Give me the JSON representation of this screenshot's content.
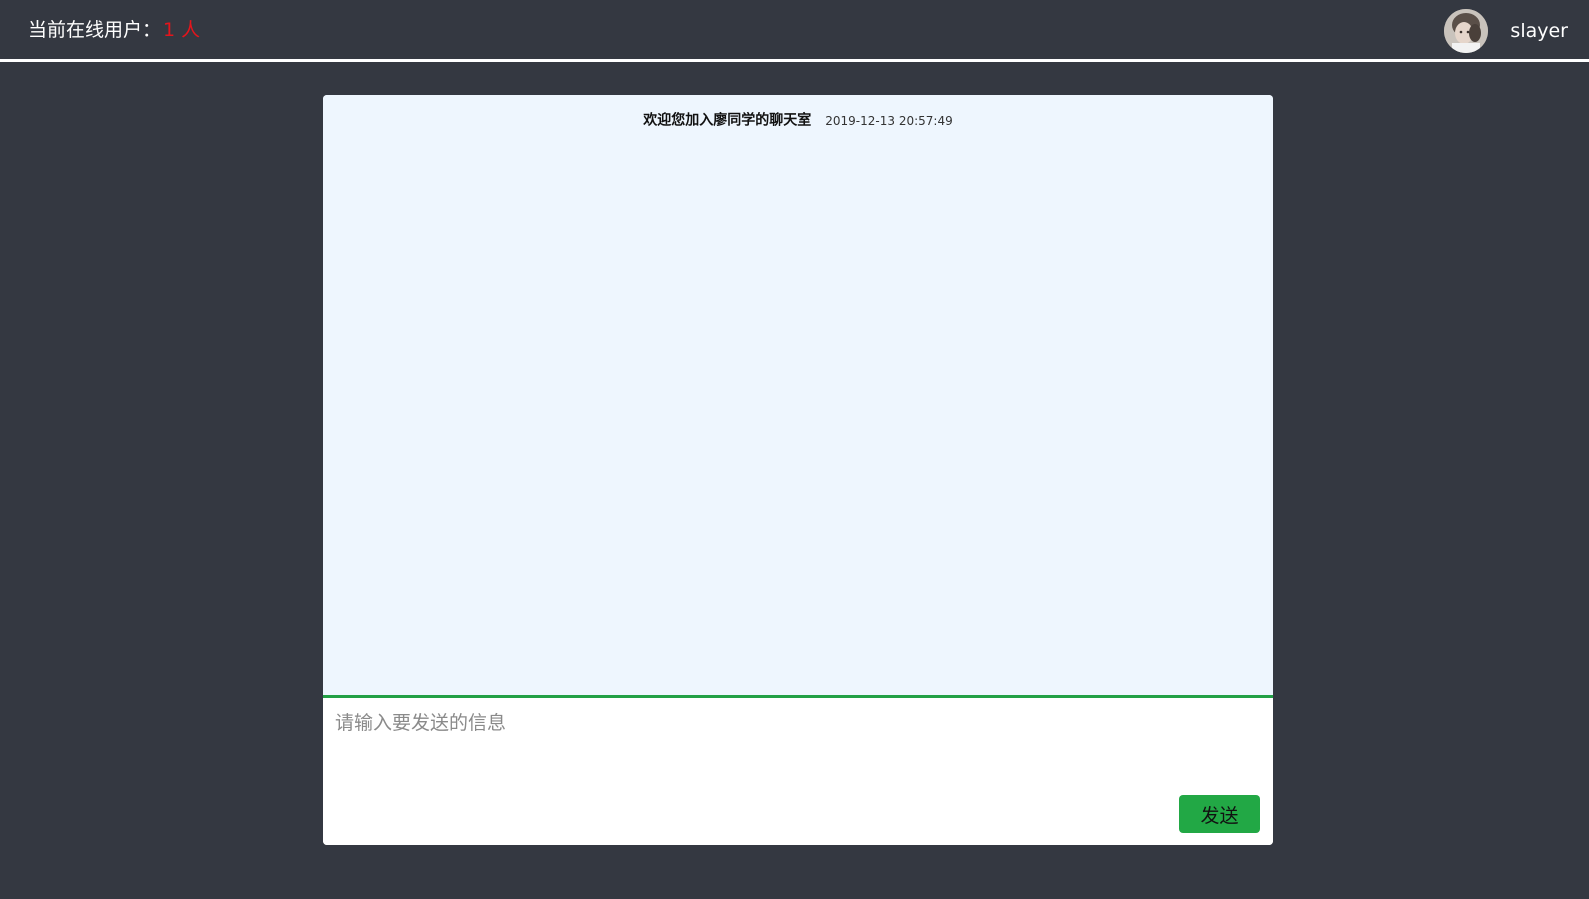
{
  "header": {
    "online_label": "当前在线用户：",
    "online_count": "1 人",
    "username": "slayer",
    "avatar_icon": "user-avatar-photo"
  },
  "chat": {
    "welcome_message": "欢迎您加入廖同学的聊天室",
    "timestamp": "2019-12-13 20:57:49"
  },
  "composer": {
    "placeholder": "请输入要发送的信息",
    "value": "",
    "send_label": "发送"
  },
  "colors": {
    "background": "#343841",
    "count_color": "#e5141b",
    "message_pane": "#eef6fe",
    "accent_green": "#22a845"
  }
}
